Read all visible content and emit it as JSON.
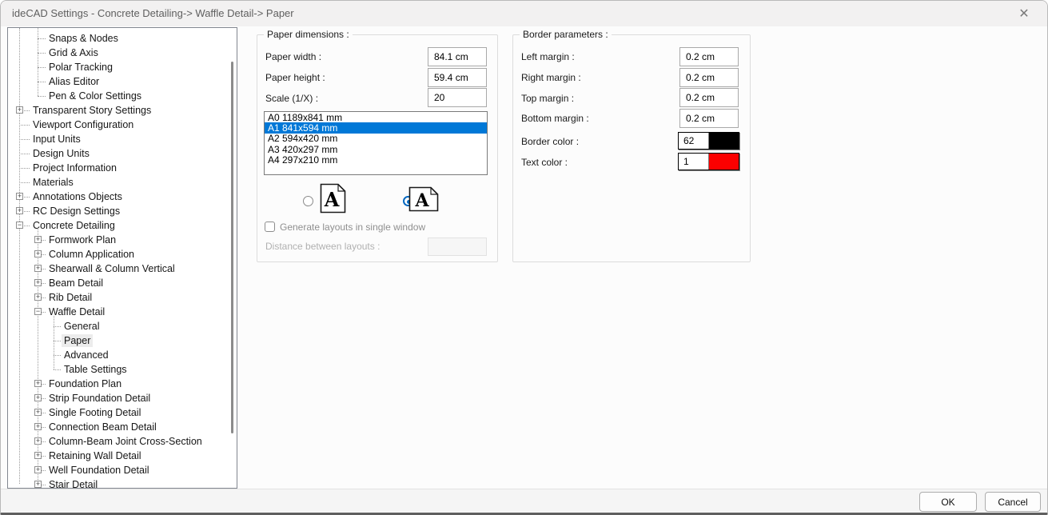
{
  "window": {
    "title": "ideCAD Settings - Concrete Detailing-> Waffle Detail-> Paper",
    "close_glyph": "✕"
  },
  "sidebar": {
    "items": [
      {
        "label": "Snaps & Nodes",
        "level": 2,
        "expand": "none",
        "selected": false
      },
      {
        "label": "Grid & Axis",
        "level": 2,
        "expand": "none",
        "selected": false
      },
      {
        "label": "Polar Tracking",
        "level": 2,
        "expand": "none",
        "selected": false
      },
      {
        "label": "Alias Editor",
        "level": 2,
        "expand": "none",
        "selected": false
      },
      {
        "label": "Pen & Color Settings",
        "level": 2,
        "expand": "none",
        "selected": false
      },
      {
        "label": "Transparent Story Settings",
        "level": 1,
        "expand": "plus",
        "selected": false
      },
      {
        "label": "Viewport Configuration",
        "level": 1,
        "expand": "none",
        "selected": false
      },
      {
        "label": "Input Units",
        "level": 1,
        "expand": "none",
        "selected": false
      },
      {
        "label": "Design Units",
        "level": 1,
        "expand": "none",
        "selected": false
      },
      {
        "label": "Project Information",
        "level": 1,
        "expand": "none",
        "selected": false
      },
      {
        "label": "Materials",
        "level": 1,
        "expand": "none",
        "selected": false
      },
      {
        "label": "Annotations Objects",
        "level": 1,
        "expand": "plus",
        "selected": false
      },
      {
        "label": "RC Design Settings",
        "level": 1,
        "expand": "plus",
        "selected": false
      },
      {
        "label": "Concrete Detailing",
        "level": 1,
        "expand": "minus",
        "selected": false
      },
      {
        "label": "Formwork Plan",
        "level": 2,
        "expand": "plus",
        "selected": false
      },
      {
        "label": "Column Application",
        "level": 2,
        "expand": "plus",
        "selected": false
      },
      {
        "label": "Shearwall & Column Vertical",
        "level": 2,
        "expand": "plus",
        "selected": false
      },
      {
        "label": "Beam Detail",
        "level": 2,
        "expand": "plus",
        "selected": false
      },
      {
        "label": "Rib Detail",
        "level": 2,
        "expand": "plus",
        "selected": false
      },
      {
        "label": "Waffle Detail",
        "level": 2,
        "expand": "minus",
        "selected": false
      },
      {
        "label": "General",
        "level": 3,
        "expand": "none",
        "selected": false
      },
      {
        "label": "Paper",
        "level": 3,
        "expand": "none",
        "selected": true
      },
      {
        "label": "Advanced",
        "level": 3,
        "expand": "none",
        "selected": false
      },
      {
        "label": "Table Settings",
        "level": 3,
        "expand": "none",
        "selected": false
      },
      {
        "label": "Foundation Plan",
        "level": 2,
        "expand": "plus",
        "selected": false
      },
      {
        "label": "Strip Foundation Detail",
        "level": 2,
        "expand": "plus",
        "selected": false
      },
      {
        "label": "Single Footing Detail",
        "level": 2,
        "expand": "plus",
        "selected": false
      },
      {
        "label": "Connection Beam Detail",
        "level": 2,
        "expand": "plus",
        "selected": false
      },
      {
        "label": "Column-Beam Joint Cross-Section",
        "level": 2,
        "expand": "plus",
        "selected": false
      },
      {
        "label": "Retaining Wall Detail",
        "level": 2,
        "expand": "plus",
        "selected": false
      },
      {
        "label": "Well Foundation Detail",
        "level": 2,
        "expand": "plus",
        "selected": false
      },
      {
        "label": "Stair Detail",
        "level": 2,
        "expand": "plus",
        "selected": false
      }
    ]
  },
  "paper_dimensions": {
    "legend": "Paper dimensions :",
    "paper_width_label": "Paper width :",
    "paper_width_value": "84.1 cm",
    "paper_height_label": "Paper height :",
    "paper_height_value": "59.4 cm",
    "scale_label": "Scale (1/X) :",
    "scale_value": "20",
    "paper_sizes": [
      "A0 1189x841 mm",
      "A1 841x594 mm",
      "A2 594x420 mm",
      "A3 420x297 mm",
      "A4 297x210 mm"
    ],
    "selected_size_index": 1,
    "orientation_portrait_selected": false,
    "orientation_landscape_selected": true,
    "generate_layouts_label": "Generate layouts in single window",
    "generate_layouts_checked": false,
    "distance_label": "Distance between layouts :",
    "distance_value": ""
  },
  "border_parameters": {
    "legend": "Border parameters :",
    "left_margin_label": "Left margin :",
    "left_margin_value": "0.2 cm",
    "right_margin_label": "Right margin :",
    "right_margin_value": "0.2 cm",
    "top_margin_label": "Top margin :",
    "top_margin_value": "0.2 cm",
    "bottom_margin_label": "Bottom margin :",
    "bottom_margin_value": "0.2 cm",
    "border_color_label": "Border color :",
    "border_color_index": "62",
    "border_color_hex": "#000000",
    "text_color_label": "Text color :",
    "text_color_index": "1",
    "text_color_hex": "#fb0000"
  },
  "footer": {
    "ok_label": "OK",
    "cancel_label": "Cancel"
  },
  "colors": {
    "selection_blue": "#0078d7",
    "radio_accent": "#0067c0"
  }
}
